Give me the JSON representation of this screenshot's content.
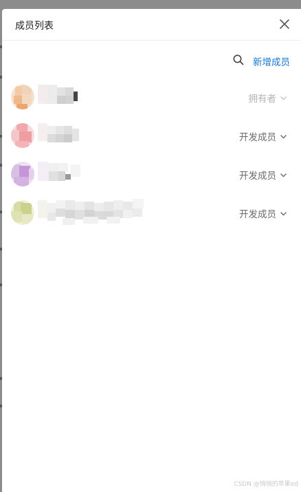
{
  "dialog": {
    "title": "成员列表",
    "close_icon": "close-icon"
  },
  "toolbar": {
    "search_icon": "search-icon",
    "add_member_label": "新增成员"
  },
  "members": [
    {
      "name": "",
      "role": "拥有者",
      "role_editable": false,
      "avatar_color": "#f2c9a0"
    },
    {
      "name": "",
      "role": "开发成员",
      "role_editable": true,
      "avatar_color": "#eea0a5"
    },
    {
      "name": "",
      "role": "开发成员",
      "role_editable": true,
      "avatar_color": "#c9a3d9"
    },
    {
      "name": "",
      "role": "开发成员",
      "role_editable": true,
      "avatar_color": "#d4dc9e"
    }
  ],
  "footer": {
    "watermark": "CSDN @悄悄的苹果ed"
  },
  "colors": {
    "accent": "#1677d2",
    "role_text": "#6b6b6b",
    "owner_text": "#b4b4b4"
  }
}
